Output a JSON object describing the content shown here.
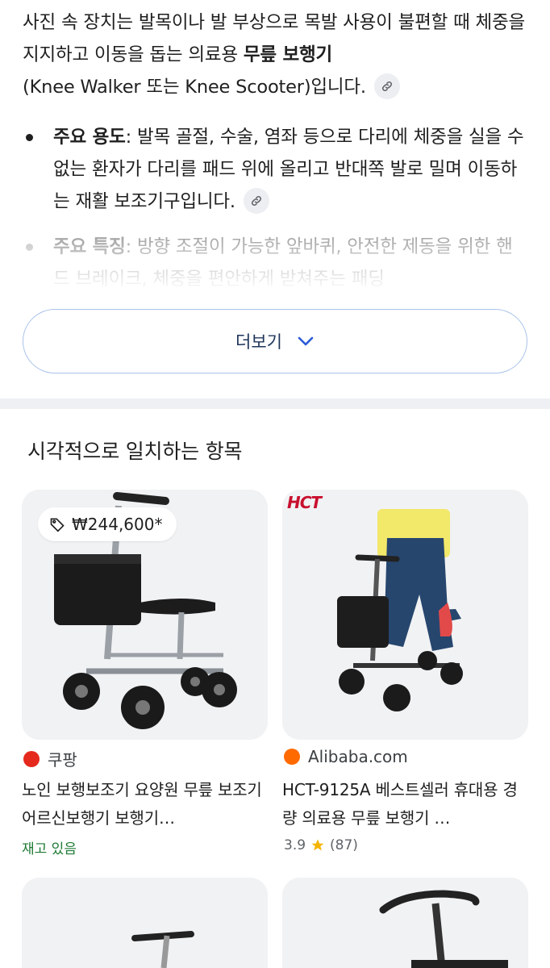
{
  "intro": {
    "text_before": "사진 속 장치는 발목이나 발 부상으로 목발 사용이 불편할 때 체중을 지지하고 이동을 돕는 의료용 ",
    "bold": "무릎 보행기",
    "text_after": "(Knee Walker 또는 Knee Scooter)입니다."
  },
  "bullets": [
    {
      "label": "주요 용도",
      "text": ": 발목 골절, 수술, 염좌 등으로 다리에 체중을 실을 수 없는 환자가 다리를 패드 위에 올리고 반대쪽 발로 밀며 이동하는 재활 보조기구입니다."
    },
    {
      "label": "주요 특징",
      "text": ": 방향 조절이 가능한 앞바퀴, 안전한 제동을 위한 핸드 브레이크, 체중을 편안하게 받쳐주는 패딩"
    }
  ],
  "more_button": {
    "label": "더보기"
  },
  "section": {
    "title": "시각적으로 일치하는 항목"
  },
  "results": [
    {
      "price": "₩244,600*",
      "source": "쿠팡",
      "title": "노인 보행보조기 요양원 무릎 보조기 어르신보행기 보행기…",
      "stock": "재고 있음"
    },
    {
      "logo_text": "HCT",
      "source": "Alibaba.com",
      "title": "HCT-9125A 베스트셀러 휴대용 경량 의료용 무릎 보행기 …",
      "rating": "3.9",
      "reviews": "(87)"
    }
  ],
  "colors": {
    "accent_border": "#a9c3ea",
    "stock_green": "#1e7a34",
    "coupang_red": "#e5291d",
    "alibaba_orange": "#ff6a00",
    "star": "#f4b400"
  },
  "icons": [
    "link-icon",
    "chevron-down-icon",
    "price-tag-icon",
    "star-icon"
  ]
}
